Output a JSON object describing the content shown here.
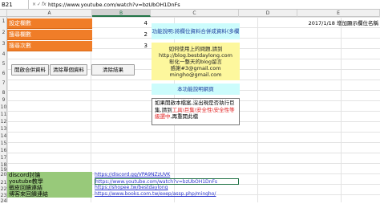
{
  "formula_bar": {
    "cell_ref": "B21",
    "cancel_glyph": "×",
    "confirm_glyph": "✓",
    "fx_glyph": "fx",
    "content": "https://www.youtube.com/watch?v=bzUbOH1DnFs"
  },
  "columns": [
    "A",
    "B",
    "C",
    "D",
    "E"
  ],
  "rows": [
    "1",
    "2",
    "3",
    "4",
    "5",
    "6",
    "7",
    "8",
    "9",
    "10",
    "11",
    "12",
    "13",
    "14",
    "15",
    "16",
    "17",
    "18",
    "19",
    "20",
    "21",
    "22",
    "23",
    "24"
  ],
  "labels": {
    "row1": "設定欄數",
    "row2": "搜尋欄數",
    "row3": "搜尋次數"
  },
  "values": {
    "row1": "4",
    "row2": "2",
    "row3": "3"
  },
  "buttons": {
    "open_merge": "開啟合併資料",
    "clear_merge": "清除單個資料",
    "clear_result": "清除結果"
  },
  "info_title": "功能說明:將欄位資料合併成資料(多欄位彙集)",
  "contact": {
    "line1": "如何使用上的問題,請到",
    "line2": "http://blog.bestdaylong.com",
    "line3": "彰化一整天的blog留言",
    "line4": "感謝#3@gmail.com mingho@gmail.com"
  },
  "feature_link_label": "本功能說明網頁",
  "note": {
    "part1": "如果開啟本檔案,沒出現是否執行巨集,請到",
    "part2_red": "工具\\巨集\\安全性\\安全性等級選中",
    "part3": ",再重開此檔"
  },
  "update_note": "2017/1/18  增加顯示欄位名稱",
  "bottom_rows": [
    {
      "label": "discord討論",
      "link": "https://discord.gg/VPA9NZzUVK"
    },
    {
      "label": "youtube教學",
      "link": "https://www.youtube.com/watch?v=bzUbOH1DnFs"
    },
    {
      "label": "蝦皮回饋連結",
      "link": "https://shopee.tw/bestdaylong"
    },
    {
      "label": "博客來回饋連結",
      "link": "https://www.books.com.tw/exep/assp.php/mingho/"
    }
  ]
}
